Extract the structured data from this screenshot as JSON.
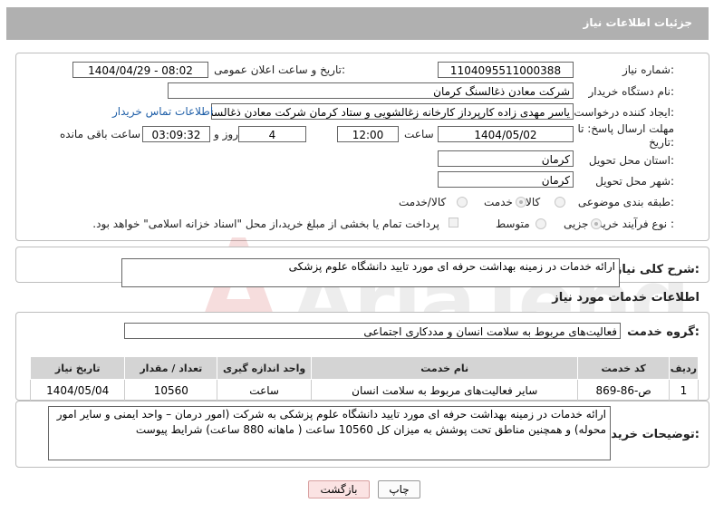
{
  "header": {
    "title": "جزئیات اطلاعات نیاز"
  },
  "form": {
    "need_number_label": "شماره نیاز:",
    "need_number": "1104095511000388",
    "announce_label": "تاریخ و ساعت اعلان عمومی:",
    "announce_value": "1404/04/29 - 08:02",
    "buyer_org_label": "نام دستگاه خریدار:",
    "buyer_org": "شرکت معادن ذغالسنگ کرمان",
    "creator_label": "ایجاد کننده درخواست:",
    "creator": "یاسر مهدی زاده کارپرداز کارخانه زغالشویی و ستاد کرمان شرکت معادن ذغالسنگ کرمان",
    "contact_link": "اطلاعات تماس خریدار",
    "deadline_label_1": "مهلت ارسال پاسخ: تا",
    "deadline_label_2": "تاریخ:",
    "deadline_date": "1404/05/02",
    "time_label": "ساعت",
    "deadline_time": "12:00",
    "days_value": "4",
    "days_label": "روز و",
    "remaining_time": "03:09:32",
    "remaining_label": "ساعت باقی مانده",
    "province_label": "استان محل تحویل:",
    "province": "کرمان",
    "city_label": "شهر محل تحویل:",
    "city": "کرمان",
    "category_label": "طبقه بندی موضوعی:",
    "category_options": [
      "کالا",
      "خدمت",
      "کالا/خدمت"
    ],
    "category_selected": "خدمت",
    "process_label": "نوع فرآیند خرید :",
    "process_options": [
      "جزیی",
      "متوسط"
    ],
    "process_selected": "جزیی",
    "payment_note": "پرداخت تمام یا بخشی از مبلغ خرید،از محل \"اسناد خزانه اسلامی\" خواهد بود."
  },
  "summary": {
    "label": "شرح کلی نیاز:",
    "text": "ارائه خدمات در زمینه بهداشت حرفه ای مورد تایید دانشگاه علوم پزشکی"
  },
  "services": {
    "section_title": "اطلاعات خدمات مورد نیاز",
    "group_label": "گروه خدمت:",
    "group_value": "فعالیت‌های مربوط به سلامت انسان و مددکاری اجتماعی",
    "columns": [
      "ردیف",
      "کد خدمت",
      "نام خدمت",
      "واحد اندازه گیری",
      "تعداد / مقدار",
      "تاریخ نیاز"
    ],
    "rows": [
      [
        "1",
        "ص-86-869",
        "سایر فعالیت‌های مربوط به سلامت انسان",
        "ساعت",
        "10560",
        "1404/05/04"
      ]
    ]
  },
  "buyer_notes": {
    "label": "توضیحات خریدار:",
    "text": "ارائه خدمات در زمینه بهداشت حرفه ای مورد تایید دانشگاه علوم پزشکی به شرکت (امور درمان – واحد ایمنی و سایر امور محوله) و همچنین مناطق تحت پوشش به میزان کل 10560 ساعت ( ماهانه 880 ساعت) شرایط پیوست"
  },
  "buttons": {
    "print": "چاپ",
    "back": "بازگشت"
  },
  "watermark": {
    "text": "AriaTender.net"
  }
}
